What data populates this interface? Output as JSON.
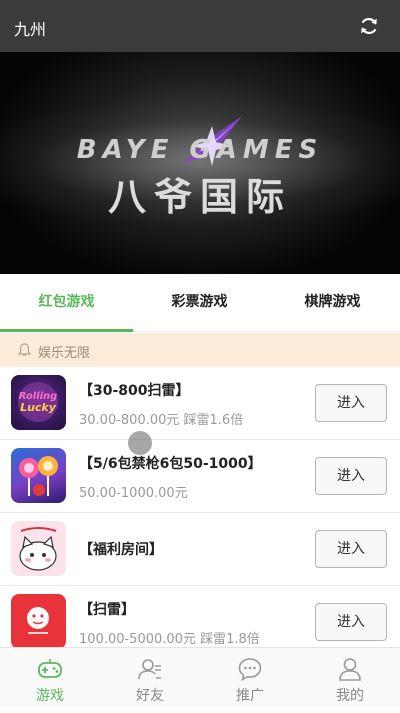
{
  "header": {
    "title": "九州",
    "refresh_icon": "refresh-icon"
  },
  "banner": {
    "logo_en": "BAYE GAMES",
    "logo_cn": "八爷国际",
    "slides": 1,
    "active_slide": 1
  },
  "tabs": [
    {
      "label": "红包游戏",
      "active": true
    },
    {
      "label": "彩票游戏",
      "active": false
    },
    {
      "label": "棋牌游戏",
      "active": false
    }
  ],
  "notice": {
    "text": "娱乐无限",
    "icon": "bell-icon"
  },
  "games": [
    {
      "name": "【30-800扫雷】",
      "sub": "30.00-800.00元 踩雷1.6倍",
      "button": "进入",
      "thumb": "lucky-game-thumbnail"
    },
    {
      "name": "【5/6包禁枪6包50-1000】",
      "sub": "50.00-1000.00元",
      "button": "进入",
      "thumb": "candy-game-thumbnail"
    },
    {
      "name": "【福利房间】",
      "sub": "",
      "button": "进入",
      "thumb": "cat-welfare-thumbnail"
    },
    {
      "name": "【扫雷】",
      "sub": "100.00-5000.00元 踩雷1.8倍",
      "button": "进入",
      "thumb": "red-minesweeper-thumbnail"
    }
  ],
  "nav": [
    {
      "label": "游戏",
      "icon": "gamepad-icon",
      "active": true
    },
    {
      "label": "好友",
      "icon": "friends-icon",
      "active": false
    },
    {
      "label": "推广",
      "icon": "chat-bubble-icon",
      "active": false
    },
    {
      "label": "我的",
      "icon": "user-icon",
      "active": false
    }
  ],
  "colors": {
    "accent": "#59b85c",
    "topbar": "#3b3b3b",
    "notice_bg": "#faecd8"
  }
}
